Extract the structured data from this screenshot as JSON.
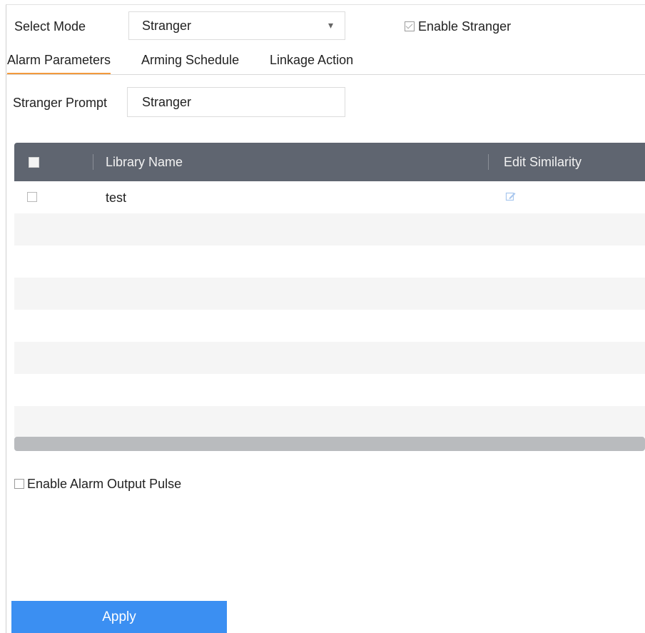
{
  "mode": {
    "label": "Select Mode",
    "selected": "Stranger",
    "enable_label": "Enable Stranger",
    "enable_checked": true
  },
  "tabs": [
    {
      "label": "Alarm Parameters",
      "active": true
    },
    {
      "label": "Arming Schedule",
      "active": false
    },
    {
      "label": "Linkage Action",
      "active": false
    }
  ],
  "prompt": {
    "label": "Stranger Prompt",
    "value": "Stranger"
  },
  "table": {
    "columns": [
      "Library Name",
      "Edit Similarity"
    ],
    "rows": [
      {
        "name": "test",
        "checked": false
      }
    ]
  },
  "pulse": {
    "label": "Enable Alarm Output Pulse",
    "checked": false
  },
  "apply_label": "Apply",
  "colors": {
    "accent": "#3b8ff2",
    "tab_underline": "#f39a3d",
    "table_header": "#5f6570"
  },
  "icons": {
    "mode_caret": "chevron-down-icon",
    "edit": "edit-icon"
  }
}
